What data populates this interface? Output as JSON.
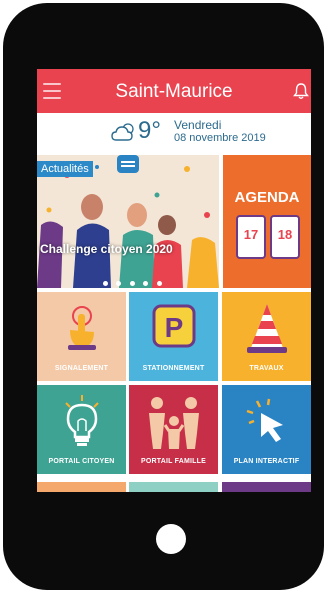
{
  "header": {
    "title": "Saint-Maurice"
  },
  "weather": {
    "temperature": "9°",
    "day": "Vendredi",
    "date": "08 novembre 2019"
  },
  "hero": {
    "badge": "Actualités",
    "caption": "Challenge citoyen 2020",
    "slide_count": 5
  },
  "agenda": {
    "label": "AGENDA",
    "day1": "17",
    "day2": "18"
  },
  "tiles": [
    {
      "label": "SIGNALEMENT",
      "color": "#f4c9a8"
    },
    {
      "label": "STATIONNEMENT",
      "color": "#4cb3dc"
    },
    {
      "label": "TRAVAUX",
      "color": "#f7b12c"
    },
    {
      "label": "PORTAIL CITOYEN",
      "color": "#3fa393"
    },
    {
      "label": "PORTAIL FAMILLE",
      "color": "#c62f47"
    },
    {
      "label": "PLAN INTERACTIF",
      "color": "#2a84c4"
    }
  ],
  "colors": {
    "header": "#e8434f",
    "weather_text": "#2c6b8e",
    "agenda": "#ec6d2c"
  }
}
